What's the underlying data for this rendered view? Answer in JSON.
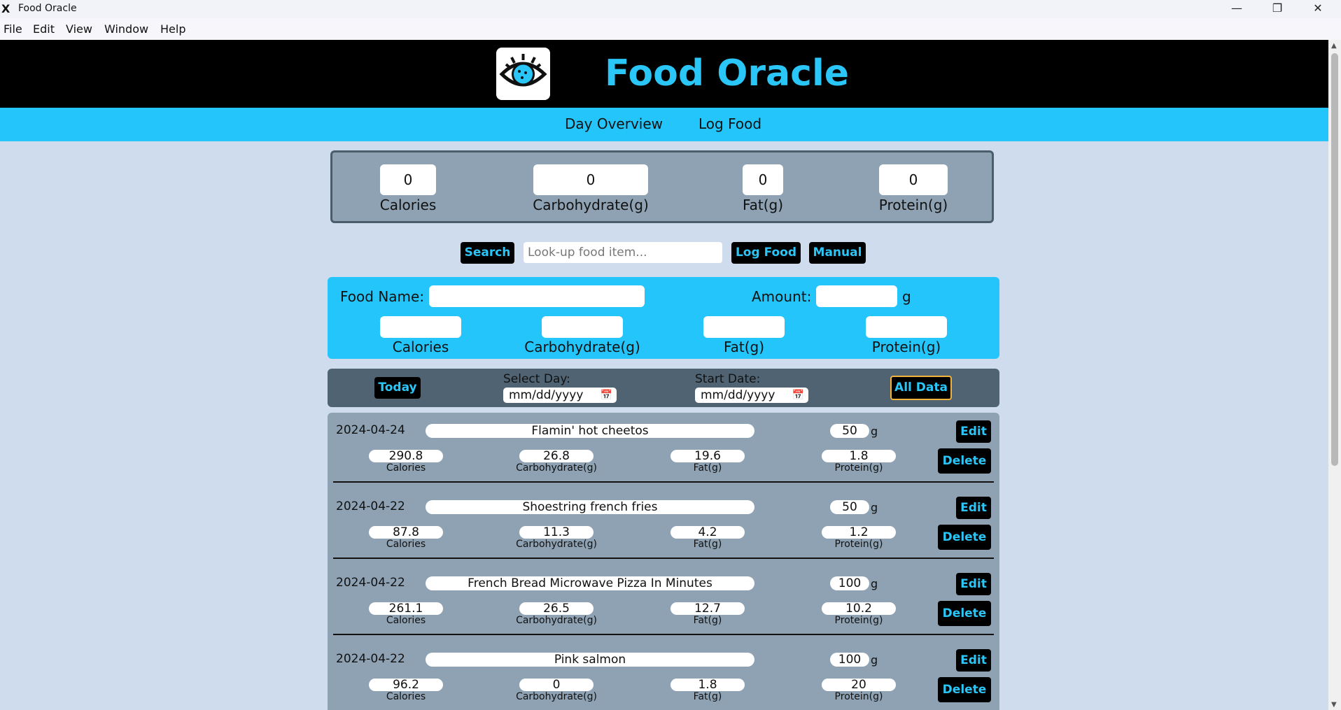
{
  "window": {
    "title": "Food Oracle",
    "app_icon": "X"
  },
  "menu": [
    "File",
    "Edit",
    "Window",
    "View",
    "Help"
  ],
  "menu_ordered": {
    "file": "File",
    "edit": "Edit",
    "view": "View",
    "window": "Window",
    "help": "Help"
  },
  "header": {
    "brand": "Food Oracle",
    "logo_icon": "eye-cookie-icon"
  },
  "nav": {
    "day_overview": "Day Overview",
    "log_food": "Log Food"
  },
  "totals": {
    "calories": {
      "value": "0",
      "label": "Calories"
    },
    "carbs": {
      "value": "0",
      "label": "Carbohydrate(g)"
    },
    "fat": {
      "value": "0",
      "label": "Fat(g)"
    },
    "protein": {
      "value": "0",
      "label": "Protein(g)"
    }
  },
  "search": {
    "button": "Search",
    "placeholder": "Look-up food item...",
    "log_food_button": "Log Food",
    "manual_button": "Manual"
  },
  "manual": {
    "food_name_label": "Food Name:",
    "amount_label": "Amount:",
    "amount_unit": "g",
    "calories_label": "Calories",
    "carbs_label": "Carbohydrate(g)",
    "fat_label": "Fat(g)",
    "protein_label": "Protein(g)"
  },
  "filter": {
    "today": "Today",
    "select_day_label": "Select Day:",
    "select_day_value": "mm/dd/yyyy",
    "start_date_label": "Start Date:",
    "start_date_value": "mm/dd/yyyy",
    "all_data": "All Data"
  },
  "log_labels": {
    "calories": "Calories",
    "carbs": "Carbohydrate(g)",
    "fat": "Fat(g)",
    "protein": "Protein(g)",
    "unit": "g",
    "edit": "Edit",
    "delete": "Delete"
  },
  "entries": [
    {
      "date": "2024-04-24",
      "name": "Flamin' hot cheetos",
      "amount": "50",
      "calories": "290.8",
      "carbs": "26.8",
      "fat": "19.6",
      "protein": "1.8"
    },
    {
      "date": "2024-04-22",
      "name": "Shoestring french fries",
      "amount": "50",
      "calories": "87.8",
      "carbs": "11.3",
      "fat": "4.2",
      "protein": "1.2"
    },
    {
      "date": "2024-04-22",
      "name": "French Bread Microwave Pizza In Minutes",
      "amount": "100",
      "calories": "261.1",
      "carbs": "26.5",
      "fat": "12.7",
      "protein": "10.2"
    },
    {
      "date": "2024-04-22",
      "name": "Pink salmon",
      "amount": "100",
      "calories": "96.2",
      "carbs": "0",
      "fat": "1.8",
      "protein": "20"
    }
  ]
}
